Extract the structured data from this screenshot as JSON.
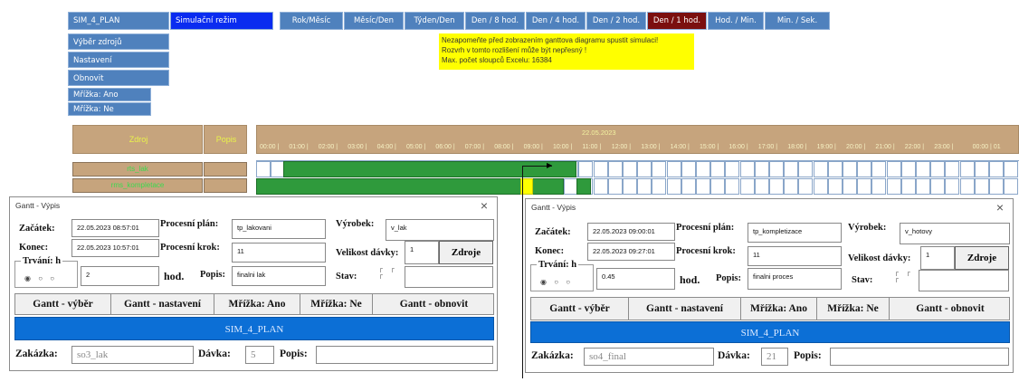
{
  "toolbar": {
    "plan": "SIM_4_PLAN",
    "mode": "Simulační režim",
    "scales": [
      "Rok/Měsíc",
      "Měsíc/Den",
      "Týden/Den",
      "Den / 8 hod.",
      "Den / 4 hod.",
      "Den / 2 hod.",
      "Den / 1 hod.",
      "Hod. / Min.",
      "Min. / Sek."
    ],
    "active_scale": "Den / 1 hod."
  },
  "side_menu": [
    "Výběr zdrojů",
    "Nastavení",
    "Obnovit",
    "Mřížka: Ano",
    "Mřížka: Ne"
  ],
  "warning": [
    "Nezapomeňte před zobrazením ganttova diagramu spustit simulaci!",
    "Rozvrh v tomto rozlišení může být nepřesný !",
    "Max. počet sloupců Excelu: 16384"
  ],
  "gantt": {
    "col_zdroj": "Zdroj",
    "col_popis": "Popis",
    "date": "22.05.2023",
    "hours": [
      "00:00",
      "01:00",
      "02:00",
      "03:00",
      "04:00",
      "05:00",
      "06:00",
      "07:00",
      "08:00",
      "09:00",
      "10:00",
      "11:00",
      "12:00",
      "13:00",
      "14:00",
      "15:00",
      "16:00",
      "17:00",
      "18:00",
      "19:00",
      "20:00",
      "21:00",
      "22:00",
      "23:00"
    ],
    "next_hours": "00:00 | 01",
    "rows": [
      "rts_lak",
      "rms_kompletace"
    ]
  },
  "dialog1": {
    "title": "Gantt - Výpis",
    "zacatek_label": "Začátek:",
    "zacatek": "22.05.2023 08:57:01",
    "konec_label": "Konec:",
    "konec": "22.05.2023 10:57:01",
    "trvani_label": "Trvání: h",
    "trvani": "2",
    "hod": "hod.",
    "plan_label": "Procesní plán:",
    "plan": "tp_lakovani",
    "krok_label": "Procesní krok:",
    "krok": "11",
    "popis_label": "Popis:",
    "popis": "finalni lak",
    "vyrobek_label": "Výrobek:",
    "vyrobek": "v_lak",
    "davka_label": "Velikost dávky:",
    "davka": "1",
    "stav_label": "Stav:",
    "stav": "",
    "zdroje": "Zdroje",
    "buttons": [
      "Gantt - výběr",
      "Gantt - nastavení",
      "Mřížka: Ano",
      "Mřížka: Ne",
      "Gantt - obnovit"
    ],
    "plan_name": "SIM_4_PLAN",
    "zakazka_label": "Zakázka:",
    "zakazka": "so3_lak",
    "davka2_label": "Dávka:",
    "davka2": "5",
    "popis2_label": "Popis:",
    "popis2": ""
  },
  "dialog2": {
    "title": "Gantt - Výpis",
    "zacatek_label": "Začátek:",
    "zacatek": "22.05.2023 09:00:01",
    "konec_label": "Konec:",
    "konec": "22.05.2023 09:27:01",
    "trvani_label": "Trvání: h",
    "trvani": "0.45",
    "hod": "hod.",
    "plan_label": "Procesní plán:",
    "plan": "tp_kompletizace",
    "krok_label": "Procesní krok:",
    "krok": "11",
    "popis_label": "Popis:",
    "popis": "finalni proces",
    "vyrobek_label": "Výrobek:",
    "vyrobek": "v_hotovy",
    "davka_label": "Velikost dávky:",
    "davka": "1",
    "stav_label": "Stav:",
    "stav": "",
    "zdroje": "Zdroje",
    "buttons": [
      "Gantt - výběr",
      "Gantt - nastavení",
      "Mřížka: Ano",
      "Mřížka: Ne",
      "Gantt - obnovit"
    ],
    "plan_name": "SIM_4_PLAN",
    "zakazka_label": "Zakázka:",
    "zakazka": "so4_final",
    "davka2_label": "Dávka:",
    "davka2": "21",
    "popis2_label": "Popis:",
    "popis2": ""
  }
}
